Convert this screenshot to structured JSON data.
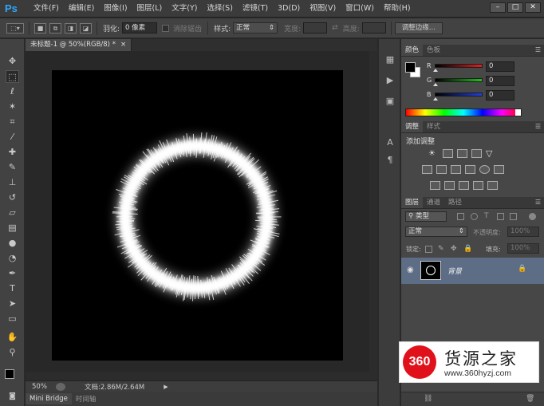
{
  "app": {
    "logo": "Ps"
  },
  "menu": [
    "文件(F)",
    "编辑(E)",
    "图像(I)",
    "图层(L)",
    "文字(Y)",
    "选择(S)",
    "滤镜(T)",
    "3D(D)",
    "视图(V)",
    "窗口(W)",
    "帮助(H)"
  ],
  "window_controls": {
    "minimize": "–",
    "restore": "□",
    "close": "✕"
  },
  "options": {
    "feather_label": "羽化:",
    "feather_value": "0 像素",
    "antialias_label": "消除锯齿",
    "style_label": "样式:",
    "style_value": "正常",
    "width_label": "宽度:",
    "height_label": "高度:",
    "refine_edge": "调整边缘..."
  },
  "document": {
    "tab_title": "未标题-1 @ 50%(RGB/8) *",
    "tab_close": "×",
    "zoom": "50%",
    "doc_info": "文档:2.86M/2.64M"
  },
  "bottom_tabs": [
    "Mini Bridge",
    "时间轴"
  ],
  "color_panel": {
    "tabs": [
      "颜色",
      "色板"
    ],
    "channels": [
      {
        "label": "R",
        "value": "0",
        "color": "#e02020"
      },
      {
        "label": "G",
        "value": "0",
        "color": "#20c020"
      },
      {
        "label": "B",
        "value": "0",
        "color": "#2040e0"
      }
    ]
  },
  "adjust_panel": {
    "tabs": [
      "调整",
      "样式"
    ],
    "title": "添加调整"
  },
  "layers_panel": {
    "tabs": [
      "图层",
      "通道",
      "路径"
    ],
    "filter": "类型",
    "blend": "正常",
    "opacity_label": "不透明度:",
    "opacity_value": "100%",
    "lock_label": "锁定:",
    "fill_label": "填充:",
    "fill_value": "100%",
    "layer_name": "背景"
  },
  "watermark": {
    "logo": "360",
    "title": "货源之家",
    "url": "www.360hyzj.com"
  },
  "colors": {
    "ps_blue": "#2ea7ff",
    "layer_selected": "#5d6d86",
    "watermark_red": "#e1111b"
  }
}
